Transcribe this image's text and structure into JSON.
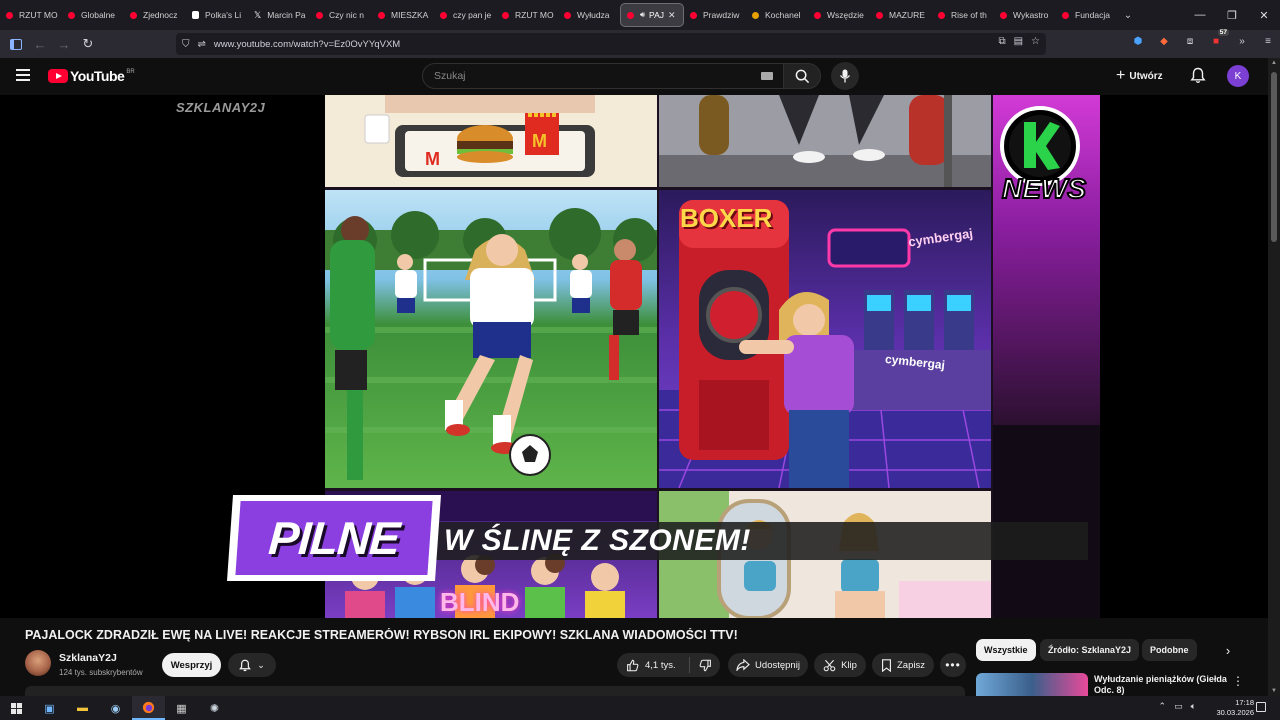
{
  "browser": {
    "tabs": [
      {
        "label": "RZUT MO",
        "icon": "youtube-icon"
      },
      {
        "label": "Globalne",
        "icon": "youtube-icon"
      },
      {
        "label": "Zjednocz",
        "icon": "youtube-icon"
      },
      {
        "label": "Polka's Li",
        "icon": "tiktok-icon"
      },
      {
        "label": "Marcin Pa",
        "icon": "x-icon"
      },
      {
        "label": "Czy nic n",
        "icon": "youtube-icon"
      },
      {
        "label": "MIESZKA",
        "icon": "youtube-icon"
      },
      {
        "label": "czy pan je",
        "icon": "youtube-icon"
      },
      {
        "label": "RZUT MO",
        "icon": "youtube-icon"
      },
      {
        "label": "Wyłudza",
        "icon": "youtube-icon"
      },
      {
        "label": "PAJ",
        "icon": "youtube-icon",
        "active": true
      },
      {
        "label": "Prawdziw",
        "icon": "youtube-icon"
      },
      {
        "label": "Kochanel",
        "icon": "smiley-icon"
      },
      {
        "label": "Wszędzie",
        "icon": "youtube-icon"
      },
      {
        "label": "MAZURE",
        "icon": "youtube-icon"
      },
      {
        "label": "Rise of th",
        "icon": "youtube-icon"
      },
      {
        "label": "Wykastro",
        "icon": "youtube-icon"
      },
      {
        "label": "Fundacja",
        "icon": "youtube-icon"
      }
    ],
    "url": "www.youtube.com/watch?v=Ez0OvYYqVXM",
    "extension_badge": "57"
  },
  "youtube": {
    "logo_text": "YouTube",
    "country_code": "BR",
    "search_placeholder": "Szukaj",
    "create_label": "Utwórz",
    "avatar_letter": "K",
    "accent_color": "#ff0033"
  },
  "video": {
    "watermark": "SZKLANAY2J",
    "overlay_tag": "PILNE",
    "overlay_text": "W ŚLINĘ Z SZONEM!",
    "panel_texts": {
      "boxer": "BOXER",
      "brand": "cymbergaj",
      "blind": "BLIND",
      "news_logo": "NEWS"
    }
  },
  "details": {
    "title": "PAJALOCK ZDRADZIŁ EWĘ NA LIVE! REAKCJE STREAMERÓW! RYBSON IRL EKIPOWY! SZKLANA WIADOMOŚCI TTV!",
    "channel_name": "SzklanaY2J",
    "subscribers": "124 tys. subskrybentów",
    "support_label": "Wesprzyj",
    "likes": "4,1 tys.",
    "share_label": "Udostępnij",
    "clip_label": "Klip",
    "save_label": "Zapisz"
  },
  "sidebar": {
    "chips": [
      "Wszystkie",
      "Źródło: SzklanaY2J",
      "Podobne"
    ],
    "related": [
      {
        "title": "Wyłudzanie pieniążków (Giełda Odc. 8)"
      }
    ]
  },
  "taskbar": {
    "time": "17:18",
    "date": "30.03.2026"
  }
}
